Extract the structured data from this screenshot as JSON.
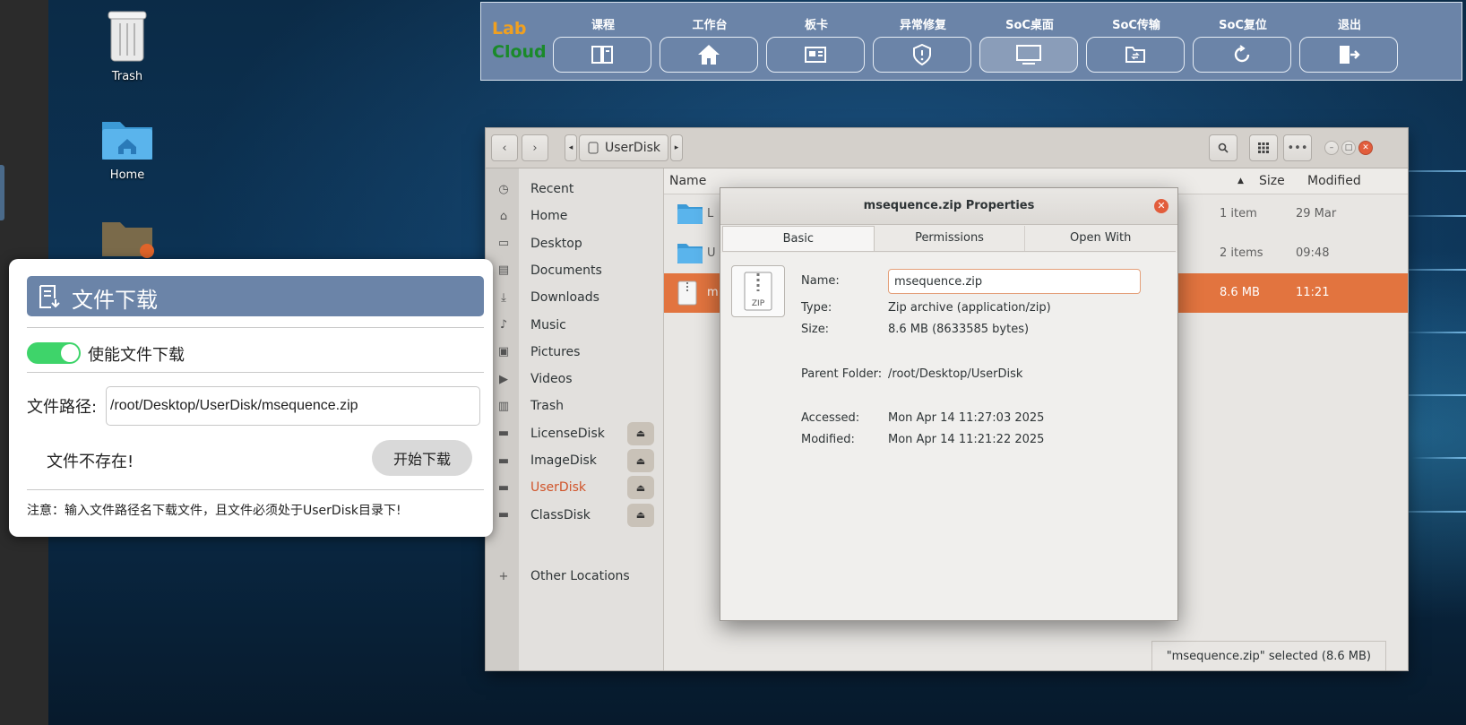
{
  "desktop": {
    "icons": [
      {
        "label": "Trash"
      },
      {
        "label": "Home"
      }
    ]
  },
  "toolbar": {
    "logo_line1": "Lab",
    "logo_line2": "Cloud",
    "items": [
      {
        "label": "课程",
        "icon": "book-icon"
      },
      {
        "label": "工作台",
        "icon": "home-icon"
      },
      {
        "label": "板卡",
        "icon": "board-icon"
      },
      {
        "label": "异常修复",
        "icon": "shield-icon"
      },
      {
        "label": "SoC桌面",
        "icon": "monitor-icon"
      },
      {
        "label": "SoC传输",
        "icon": "folder-transfer-icon"
      },
      {
        "label": "SoC复位",
        "icon": "refresh-icon"
      },
      {
        "label": "退出",
        "icon": "exit-icon"
      }
    ]
  },
  "file_manager": {
    "path_segment": "UserDisk",
    "sidebar": [
      {
        "label": "Recent",
        "icon": "clock-icon"
      },
      {
        "label": "Home",
        "icon": "home-icon"
      },
      {
        "label": "Desktop",
        "icon": "desktop-icon"
      },
      {
        "label": "Documents",
        "icon": "documents-icon"
      },
      {
        "label": "Downloads",
        "icon": "downloads-icon"
      },
      {
        "label": "Music",
        "icon": "music-icon"
      },
      {
        "label": "Pictures",
        "icon": "pictures-icon"
      },
      {
        "label": "Videos",
        "icon": "videos-icon"
      },
      {
        "label": "Trash",
        "icon": "trash-icon"
      },
      {
        "label": "LicenseDisk",
        "icon": "drive-icon",
        "eject": true
      },
      {
        "label": "ImageDisk",
        "icon": "drive-icon",
        "eject": true
      },
      {
        "label": "UserDisk",
        "icon": "drive-icon",
        "eject": true,
        "selected": true
      },
      {
        "label": "ClassDisk",
        "icon": "drive-icon",
        "eject": true
      }
    ],
    "other_locations": "Other Locations",
    "columns": {
      "name": "Name",
      "size": "Size",
      "modified": "Modified"
    },
    "rows": [
      {
        "name": "L",
        "size": "1 item",
        "modified": "29 Mar",
        "type": "folder"
      },
      {
        "name": "U",
        "size": "2 items",
        "modified": "09:48",
        "type": "folder"
      },
      {
        "name": "m",
        "size": "8.6 MB",
        "modified": "11:21",
        "type": "zip",
        "selected": true
      }
    ],
    "status": "\"msequence.zip\" selected  (8.6 MB)"
  },
  "properties_dialog": {
    "title": "msequence.zip Properties",
    "tabs": [
      "Basic",
      "Permissions",
      "Open With"
    ],
    "icon_text": "ZIP",
    "name_label": "Name:",
    "name_value": "msequence.zip",
    "type_label": "Type:",
    "type_value": "Zip archive (application/zip)",
    "size_label": "Size:",
    "size_value": "8.6 MB (8633585 bytes)",
    "parent_label": "Parent Folder:",
    "parent_value": "/root/Desktop/UserDisk",
    "accessed_label": "Accessed:",
    "accessed_value": "Mon Apr 14 11:27:03 2025",
    "modified_label": "Modified:",
    "modified_value": "Mon Apr 14 11:21:22 2025"
  },
  "download_panel": {
    "title": "文件下载",
    "toggle_label": "使能文件下载",
    "toggle_on": true,
    "path_label": "文件路径:",
    "path_value": "/root/Desktop/UserDisk/msequence.zip",
    "status_message": "文件不存在!",
    "start_button": "开始下载",
    "note": "注意：输入文件路径名下载文件，且文件必须处于UserDisk目录下!"
  },
  "colors": {
    "toolbar_bg": "#6b84a8",
    "selection": "#e2743f",
    "toggle_on": "#3ed46a",
    "close_button": "#e25d3c"
  }
}
